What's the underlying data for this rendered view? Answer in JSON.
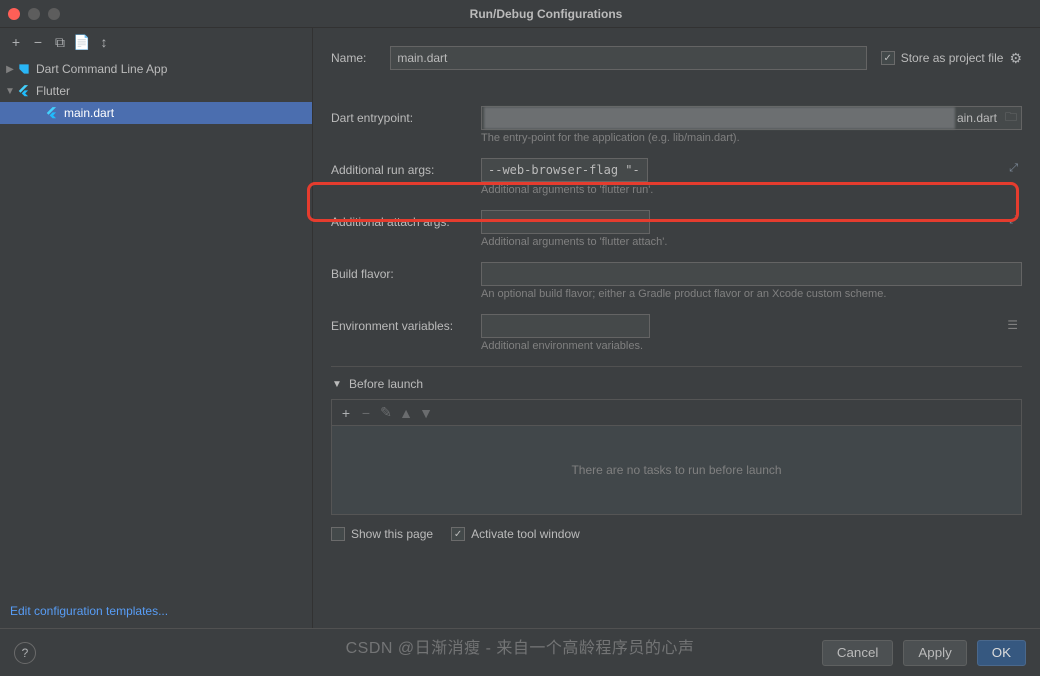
{
  "window": {
    "title": "Run/Debug Configurations"
  },
  "left_toolbar": {
    "add": "+",
    "remove": "−",
    "copy": "⧉",
    "save": "📄",
    "up_down": "↕"
  },
  "tree": {
    "dart_group": "Dart Command Line App",
    "flutter_group": "Flutter",
    "config_name": "main.dart"
  },
  "edit_templates": "Edit configuration templates...",
  "form": {
    "name_label": "Name:",
    "name_value": "main.dart",
    "store_label": "Store as project file",
    "entry_label": "Dart entrypoint:",
    "entry_tail": "ain.dart",
    "entry_help": "The entry-point for the application (e.g. lib/main.dart).",
    "run_args_label": "Additional run args:",
    "run_args_value": "--web-browser-flag \"--disable-web-security\" --web-renderer canvask",
    "run_args_help": "Additional arguments to 'flutter run'.",
    "attach_args_label": "Additional attach args:",
    "attach_args_value": "",
    "attach_args_help": "Additional arguments to 'flutter attach'.",
    "build_flavor_label": "Build flavor:",
    "build_flavor_value": "",
    "build_flavor_help": "An optional build flavor; either a Gradle product flavor or an Xcode custom scheme.",
    "env_label": "Environment variables:",
    "env_value": "",
    "env_help": "Additional environment variables."
  },
  "before_launch": {
    "title": "Before launch",
    "empty": "There are no tasks to run before launch",
    "show_page": "Show this page",
    "activate_window": "Activate tool window"
  },
  "footer": {
    "cancel": "Cancel",
    "apply": "Apply",
    "ok": "OK"
  },
  "watermark": "CSDN @日渐消瘦 - 来自一个高龄程序员的心声"
}
